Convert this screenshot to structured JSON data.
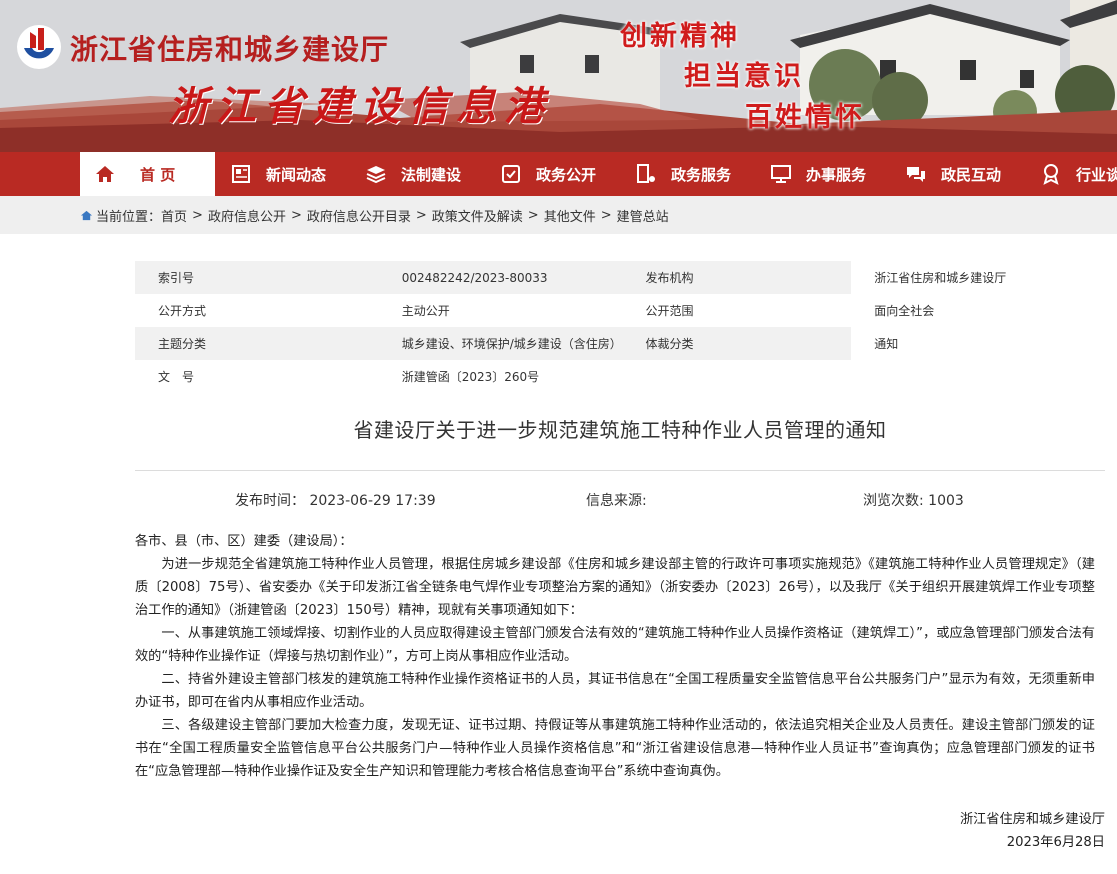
{
  "header": {
    "dept_name": "浙江省住房和城乡建设厅",
    "site_name": "浙江省建设信息港",
    "slogans": [
      "创新精神",
      "担当意识",
      "百姓情怀"
    ]
  },
  "nav": {
    "items": [
      {
        "label": "首 页",
        "icon": "home-icon",
        "active": true
      },
      {
        "label": "新闻动态",
        "icon": "news-icon"
      },
      {
        "label": "法制建设",
        "icon": "layers-icon"
      },
      {
        "label": "政务公开",
        "icon": "document-icon"
      },
      {
        "label": "政务服务",
        "icon": "service-icon"
      },
      {
        "label": "办事服务",
        "icon": "monitor-icon"
      },
      {
        "label": "政民互动",
        "icon": "chat-icon"
      },
      {
        "label": "行业谈",
        "icon": "award-icon"
      }
    ]
  },
  "breadcrumb": {
    "prefix": "当前位置：",
    "items": [
      "首页",
      "政府信息公开",
      "政府信息公开目录",
      "政策文件及解读",
      "其他文件",
      "建管总站"
    ],
    "separator": ">"
  },
  "meta": {
    "index_label": "索引号",
    "index_value": "002482242/2023-80033",
    "issuer_label": "发布机构",
    "issuer_value": "浙江省住房和城乡建设厅",
    "open_mode_label": "公开方式",
    "open_mode_value": "主动公开",
    "open_scope_label": "公开范围",
    "open_scope_value": "面向全社会",
    "topic_label": "主题分类",
    "topic_value": "城乡建设、环境保护/城乡建设（含住房）",
    "genre_label": "体裁分类",
    "genre_value": "通知",
    "doc_no_label": "文　号",
    "doc_no_value": "浙建管函〔2023〕260号"
  },
  "article": {
    "title": "省建设厅关于进一步规范建筑施工特种作业人员管理的通知",
    "publish_time_label": "发布时间：",
    "publish_time": "2023-06-29 17:39",
    "source_label": "信息来源:",
    "source": "",
    "views_label": "浏览次数:",
    "views": "1003",
    "salutation": "各市、县（市、区）建委（建设局）：",
    "paragraphs": [
      "为进一步规范全省建筑施工特种作业人员管理，根据住房城乡建设部《住房和城乡建设部主管的行政许可事项实施规范》《建筑施工特种作业人员管理规定》（建质〔2008〕75号）、省安委办《关于印发浙江省全链条电气焊作业专项整治方案的通知》（浙安委办〔2023〕26号），以及我厅《关于组织开展建筑焊工作业专项整治工作的通知》（浙建管函〔2023〕150号）精神，现就有关事项通知如下：",
      "一、从事建筑施工领域焊接、切割作业的人员应取得建设主管部门颁发合法有效的“建筑施工特种作业人员操作资格证（建筑焊工）”，或应急管理部门颁发合法有效的“特种作业操作证（焊接与热切割作业）”，方可上岗从事相应作业活动。",
      "二、持省外建设主管部门核发的建筑施工特种作业操作资格证书的人员，其证书信息在“全国工程质量安全监管信息平台公共服务门户”显示为有效，无须重新申办证书，即可在省内从事相应作业活动。",
      "三、各级建设主管部门要加大检查力度，发现无证、证书过期、持假证等从事建筑施工特种作业活动的，依法追究相关企业及人员责任。建设主管部门颁发的证书在“全国工程质量安全监管信息平台公共服务门户—特种作业人员操作资格信息”和“浙江省建设信息港—特种作业人员证书”查询真伪；应急管理部门颁发的证书在“应急管理部—特种作业操作证及安全生产知识和管理能力考核合格信息查询平台”系统中查询真伪。"
    ],
    "signature": "浙江省住房和城乡建设厅",
    "date": "2023年6月28日"
  },
  "colors": {
    "brand_red": "#b92a23",
    "title_red": "#c91818",
    "crumb_bg": "#efefef",
    "label_bg": "#f1f1f1"
  }
}
